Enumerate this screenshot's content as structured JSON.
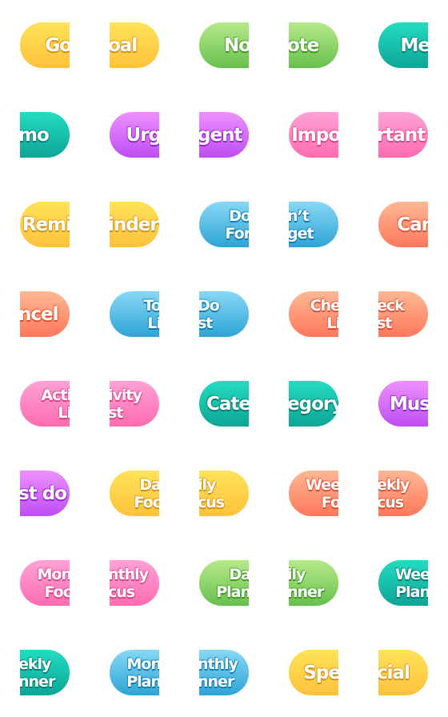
{
  "colors": {
    "yellow": "#ffc23a",
    "green": "#66c04c",
    "teal": "#0ea596",
    "purple": "#bd4ef2",
    "pink": "#ff6cb0",
    "blue": "#2ea4d6",
    "orange": "#ff785c"
  },
  "tiles": [
    {
      "side": "left",
      "color": "yellow",
      "lines": [
        "Go"
      ]
    },
    {
      "side": "right",
      "color": "yellow",
      "lines": [
        "oal"
      ]
    },
    {
      "side": "left",
      "color": "green",
      "lines": [
        "No"
      ]
    },
    {
      "side": "right",
      "color": "green",
      "lines": [
        "ote"
      ]
    },
    {
      "side": "left",
      "color": "teal",
      "lines": [
        "Me"
      ]
    },
    {
      "side": "right",
      "color": "teal",
      "lines": [
        "mo"
      ]
    },
    {
      "side": "left",
      "color": "purple",
      "lines": [
        "Urg"
      ]
    },
    {
      "side": "right",
      "color": "purple",
      "lines": [
        "gent"
      ]
    },
    {
      "side": "left",
      "color": "pink",
      "lines": [
        "Impo"
      ]
    },
    {
      "side": "right",
      "color": "pink",
      "lines": [
        "rtant"
      ]
    },
    {
      "side": "left",
      "color": "yellow",
      "lines": [
        "Remi"
      ]
    },
    {
      "side": "right",
      "color": "yellow",
      "lines": [
        "inder"
      ]
    },
    {
      "side": "left",
      "color": "blue",
      "lines": [
        "Do",
        "For"
      ]
    },
    {
      "side": "right",
      "color": "blue",
      "lines": [
        "n’t",
        "get"
      ]
    },
    {
      "side": "left",
      "color": "orange",
      "lines": [
        "Car"
      ]
    },
    {
      "side": "right",
      "color": "orange",
      "lines": [
        "ncel"
      ]
    },
    {
      "side": "left",
      "color": "blue",
      "lines": [
        "To",
        "Li"
      ]
    },
    {
      "side": "right",
      "color": "blue",
      "lines": [
        "Do",
        "st"
      ]
    },
    {
      "side": "left",
      "color": "orange",
      "lines": [
        "Che",
        "Li"
      ]
    },
    {
      "side": "right",
      "color": "orange",
      "lines": [
        "eck",
        "st"
      ]
    },
    {
      "side": "left",
      "color": "pink",
      "lines": [
        "Acti",
        "Li"
      ]
    },
    {
      "side": "right",
      "color": "pink",
      "lines": [
        "ivity",
        "st"
      ]
    },
    {
      "side": "left",
      "color": "teal",
      "lines": [
        "Cate"
      ]
    },
    {
      "side": "right",
      "color": "teal",
      "lines": [
        "egory"
      ]
    },
    {
      "side": "left",
      "color": "purple",
      "lines": [
        "Mus"
      ]
    },
    {
      "side": "right",
      "color": "purple",
      "lines": [
        "st do"
      ]
    },
    {
      "side": "left",
      "color": "yellow",
      "lines": [
        "Da",
        "Foc"
      ]
    },
    {
      "side": "right",
      "color": "yellow",
      "lines": [
        "ily",
        "cus"
      ]
    },
    {
      "side": "left",
      "color": "orange",
      "lines": [
        "Wee",
        "Fo"
      ]
    },
    {
      "side": "right",
      "color": "orange",
      "lines": [
        "ekly",
        "cus"
      ]
    },
    {
      "side": "left",
      "color": "pink",
      "lines": [
        "Mon",
        "Foc"
      ]
    },
    {
      "side": "right",
      "color": "pink",
      "lines": [
        "nthly",
        "cus"
      ]
    },
    {
      "side": "left",
      "color": "green",
      "lines": [
        "Da",
        "Plan"
      ]
    },
    {
      "side": "right",
      "color": "green",
      "lines": [
        "ily",
        "nner"
      ]
    },
    {
      "side": "left",
      "color": "teal",
      "lines": [
        "Wee",
        "Plan"
      ]
    },
    {
      "side": "right",
      "color": "teal",
      "lines": [
        "ekly",
        "nner"
      ]
    },
    {
      "side": "left",
      "color": "blue",
      "lines": [
        "Mon",
        "Plan"
      ]
    },
    {
      "side": "right",
      "color": "blue",
      "lines": [
        "nthly",
        "nner"
      ]
    },
    {
      "side": "left",
      "color": "yellow",
      "lines": [
        "Spe"
      ]
    },
    {
      "side": "right",
      "color": "yellow",
      "lines": [
        "cial"
      ]
    }
  ]
}
